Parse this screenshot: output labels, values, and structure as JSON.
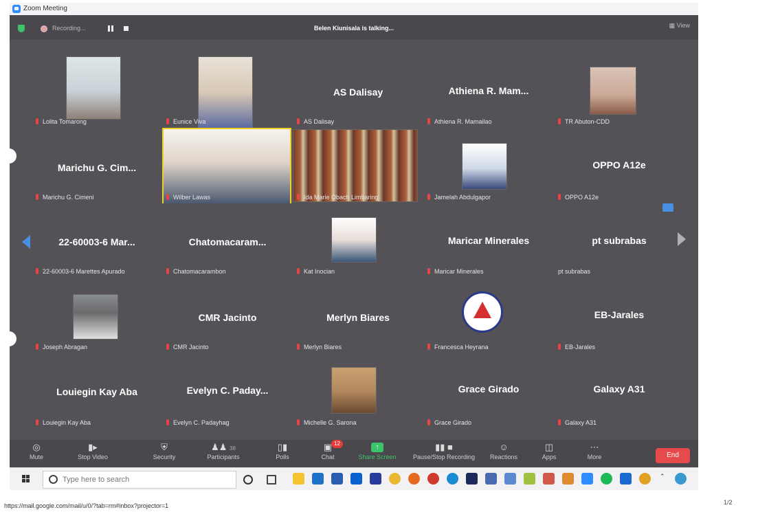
{
  "window": {
    "title": "Zoom Meeting"
  },
  "topbar": {
    "recording": "Recording...",
    "talking": "Belen Kiunisala is talking...",
    "view": "View"
  },
  "tiles": [
    {
      "label": "Lolita Tomarong",
      "display": "",
      "video": true
    },
    {
      "label": "Eunice Viva",
      "display": "",
      "video": true
    },
    {
      "label": "AS Dalisay",
      "display": "AS Dalisay",
      "video": false
    },
    {
      "label": "Athiena R. Mamailao",
      "display": "Athiena R. Mam...",
      "video": false
    },
    {
      "label": "TR Abuton-CDD",
      "display": "",
      "video": true
    },
    {
      "label": "Marichu G. Cimeni",
      "display": "Marichu G. Cim...",
      "video": false
    },
    {
      "label": "Wilber Lawas",
      "display": "",
      "video": true
    },
    {
      "label": "Ida Marie Obach Limbaring",
      "display": "",
      "video": true
    },
    {
      "label": "Jamelah Abdulgapor",
      "display": "",
      "video": true
    },
    {
      "label": "OPPO A12e",
      "display": "OPPO A12e",
      "video": false
    },
    {
      "label": "22-60003-6 Marettes Apurado",
      "display": "22-60003-6 Mar...",
      "video": false
    },
    {
      "label": "Chatomacarambon",
      "display": "Chatomacaram...",
      "video": false
    },
    {
      "label": "Kat Inocian",
      "display": "",
      "video": true
    },
    {
      "label": "Maricar Minerales",
      "display": "Maricar Minerales",
      "video": false
    },
    {
      "label": "pt subrabas",
      "display": "pt subrabas",
      "video": false
    },
    {
      "label": "Joseph Abragan",
      "display": "",
      "video": true
    },
    {
      "label": "CMR Jacinto",
      "display": "CMR Jacinto",
      "video": false
    },
    {
      "label": "Merlyn Biares",
      "display": "Merlyn Biares",
      "video": false
    },
    {
      "label": "Francesca Heyrana",
      "display": "",
      "video": true
    },
    {
      "label": "EB-Jarales",
      "display": "EB-Jarales",
      "video": false
    },
    {
      "label": "Louiegin Kay Aba",
      "display": "Louiegin Kay Aba",
      "video": false
    },
    {
      "label": "Evelyn C. Padayhag",
      "display": "Evelyn C. Paday...",
      "video": false
    },
    {
      "label": "Michelle G. Sarona",
      "display": "",
      "video": true
    },
    {
      "label": "Grace Girado",
      "display": "Grace Girado",
      "video": false
    },
    {
      "label": "Galaxy A31",
      "display": "Galaxy A31",
      "video": false
    }
  ],
  "toolbar": {
    "mute": "Mute",
    "stop_video": "Stop Video",
    "security": "Security",
    "participants": "Participants",
    "participants_count": "38",
    "polls": "Polls",
    "chat": "Chat",
    "chat_badge": "12",
    "share_screen": "Share Screen",
    "pause_recording": "Pause/Stop Recording",
    "reactions": "Reactions",
    "apps": "Apps",
    "more": "More",
    "end": "End"
  },
  "taskbar": {
    "search_placeholder": "Type here to search"
  },
  "footer": {
    "url": "https://mail.google.com/mail/u/0/?tab=rm#inbox?projector=1",
    "page": "1/2"
  },
  "colors": {
    "meeting_bg": "#545257",
    "mic_muted": "#e64545",
    "share_green": "#3cc36b",
    "end_red": "#e64a4a",
    "accent_blue": "#2d8cff"
  }
}
